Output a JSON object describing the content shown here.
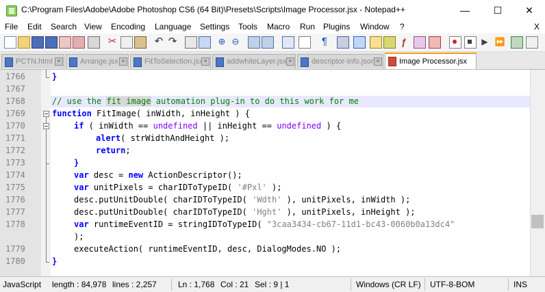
{
  "window": {
    "title": "C:\\Program Files\\Adobe\\Adobe Photoshop CS6 (64 Bit)\\Presets\\Scripts\\Image Processor.jsx - Notepad++",
    "minimize": "—",
    "maximize": "☐",
    "close": "✕"
  },
  "menu": {
    "items": [
      "File",
      "Edit",
      "Search",
      "View",
      "Encoding",
      "Language",
      "Settings",
      "Tools",
      "Macro",
      "Run",
      "Plugins",
      "Window",
      "?"
    ],
    "close_doc": "X"
  },
  "tabs": [
    {
      "label": "PCTN.html"
    },
    {
      "label": "Arrange.jsx"
    },
    {
      "label": "FitToSelection.jsx"
    },
    {
      "label": "addwhiteLayer.jsx"
    },
    {
      "label": "descriptor-info.json"
    },
    {
      "label": "Image Processor.jsx"
    }
  ],
  "editor": {
    "line_numbers": [
      "1766",
      "1767",
      "1768",
      "1769",
      "1770",
      "1771",
      "1772",
      "1773",
      "1774",
      "1775",
      "1776",
      "1777",
      "1778",
      "",
      "1779",
      "1780"
    ],
    "lines": {
      "l1766": "}",
      "l1768_a": "// use the ",
      "l1768_b": "fit image",
      "l1768_c": " automation plug-in to do this work for me",
      "l1769_kw": "function",
      "l1769_rest": " FitImage( inWidth, inHeight ) {",
      "l1770_kw": "if",
      "l1770_a": " ( inWidth == ",
      "l1770_u1": "undefined",
      "l1770_b": " || inHeight == ",
      "l1770_u2": "undefined",
      "l1770_c": " ) {",
      "l1771_kw": "alert",
      "l1771_rest": "( strWidthAndHeight );",
      "l1772_kw": "return",
      "l1772_rest": ";",
      "l1773": "}",
      "l1774_kw": "var",
      "l1774_a": " desc = ",
      "l1774_kw2": "new",
      "l1774_b": " ActionDescriptor();",
      "l1775_kw": "var",
      "l1775_a": " unitPixels = charIDToTypeID( ",
      "l1775_s": "'#Pxl'",
      "l1775_b": " );",
      "l1776_a": "desc.putUnitDouble( charIDToTypeID( ",
      "l1776_s": "'Wdth'",
      "l1776_b": " ), unitPixels, inWidth );",
      "l1777_a": "desc.putUnitDouble( charIDToTypeID( ",
      "l1777_s": "'Hght'",
      "l1777_b": " ), unitPixels, inHeight );",
      "l1778_kw": "var",
      "l1778_a": " runtimeEventID = stringIDToTypeID( ",
      "l1778_s": "\"3caa3434-cb67-11d1-bc43-0060b0a13dc4\"",
      "l1778_b": ");",
      "l1779": "executeAction( runtimeEventID, desc, DialogModes.NO );",
      "l1780": "}"
    }
  },
  "status": {
    "lang": "JavaScript",
    "length": "length : 84,978",
    "lines": "lines : 2,257",
    "ln": "Ln : 1,768",
    "col": "Col : 21",
    "sel": "Sel : 9 | 1",
    "eol": "Windows (CR LF)",
    "enc": "UTF-8-BOM",
    "ins": "INS"
  },
  "colors": {
    "accent_tab": "#f99e1a",
    "keyword": "#0000ff",
    "comment": "#008000",
    "string": "#808080",
    "current_line": "#e8e8ff"
  }
}
